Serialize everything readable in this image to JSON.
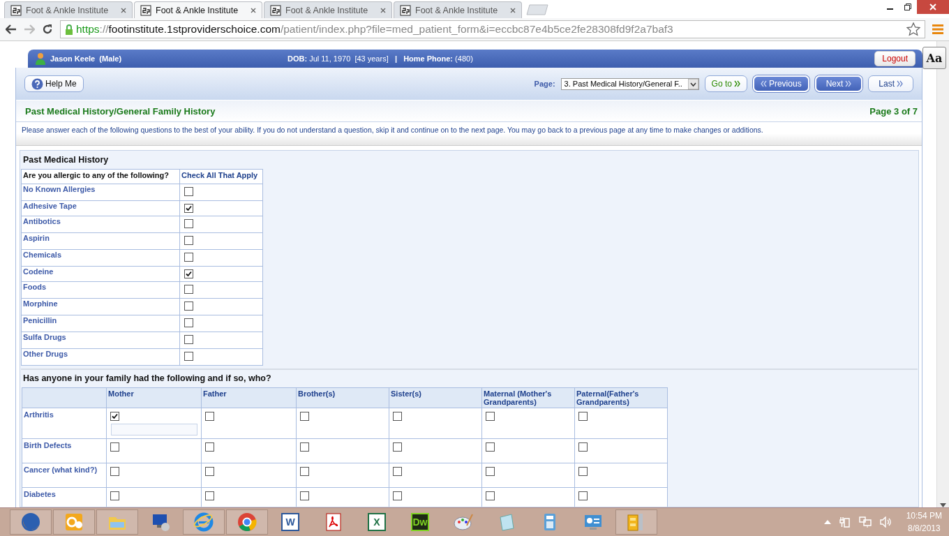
{
  "browser": {
    "tabs": [
      {
        "title": "Foot & Ankle Institute",
        "selected": false
      },
      {
        "title": "Foot & Ankle Institute",
        "selected": true
      },
      {
        "title": "Foot & Ankle Institute",
        "selected": false
      },
      {
        "title": "Foot & Ankle Institute",
        "selected": false
      }
    ],
    "url": {
      "scheme": "https",
      "separator": "://",
      "host": "footinstitute.1stproviderschoice.com",
      "path": "/patient/index.php?file=med_patient_form&i=eccbc87e4b5ce2fe28308fd9f2a7baf3"
    }
  },
  "patient": {
    "name": "Jason Keele  (Male)",
    "dob_label": "DOB:",
    "dob": "Jul 11, 1970  [43 years]",
    "separator": "|",
    "phone_label": "Home Phone:",
    "phone": "(480)"
  },
  "logout": "Logout",
  "text_size_button": "Aa",
  "help": "Help Me",
  "page_select": {
    "label": "Page:",
    "value": "3. Past Medical History/General F.."
  },
  "nav_buttons": [
    {
      "label": "Go to",
      "kind": "goto"
    },
    {
      "label": "Previous",
      "kind": "prev"
    },
    {
      "label": "Next",
      "kind": "next"
    },
    {
      "label": "Last",
      "kind": "last"
    }
  ],
  "section_title": "Past Medical History/General Family History",
  "page_count": "Page 3 of 7",
  "instructions": "Please answer each of the following questions to the best of your ability. If you do not understand a question, skip it and continue on to the next page. You may go back to a previous page at any time to make changes or additions.",
  "allergies": {
    "heading": "Past Medical History",
    "columns": [
      "Are you allergic to any of the following?",
      "Check All That Apply"
    ],
    "rows": [
      {
        "label": "No Known Allergies",
        "checked": false
      },
      {
        "label": "Adhesive Tape",
        "checked": true
      },
      {
        "label": "Antibotics",
        "checked": false
      },
      {
        "label": "Aspirin",
        "checked": false
      },
      {
        "label": "Chemicals",
        "checked": false
      },
      {
        "label": "Codeine",
        "checked": true
      },
      {
        "label": "Foods",
        "checked": false
      },
      {
        "label": "Morphine",
        "checked": false
      },
      {
        "label": "Penicillin",
        "checked": false
      },
      {
        "label": "Sulfa Drugs",
        "checked": false
      },
      {
        "label": "Other Drugs",
        "checked": false
      }
    ]
  },
  "family": {
    "question": "Has anyone in your family had the following and if so, who?",
    "columns": [
      "Mother",
      "Father",
      "Brother(s)",
      "Sister(s)",
      "Maternal (Mother's Grandparents)",
      "Paternal(Father's Grandparents)"
    ],
    "rows": [
      {
        "label": "Arthritis",
        "checks": [
          true,
          false,
          false,
          false,
          false,
          false
        ]
      },
      {
        "label": "Birth Defects",
        "checks": [
          false,
          false,
          false,
          false,
          false,
          false
        ]
      },
      {
        "label": "Cancer (what kind?)",
        "checks": [
          false,
          false,
          false,
          false,
          false,
          false
        ]
      },
      {
        "label": "Diabetes",
        "checks": [
          false,
          false,
          false,
          false,
          false,
          false
        ]
      }
    ]
  },
  "taskbar": {
    "apps": [
      {
        "kind": "firefox",
        "running": true
      },
      {
        "kind": "outlook",
        "running": true
      },
      {
        "kind": "folder",
        "running": true
      },
      {
        "kind": "remote",
        "running": false
      },
      {
        "kind": "ie",
        "running": true
      },
      {
        "kind": "chrome",
        "running": true
      },
      {
        "kind": "word",
        "running": false,
        "glyph": "W"
      },
      {
        "kind": "acrobat",
        "running": false
      },
      {
        "kind": "excel",
        "running": false,
        "glyph": "X"
      },
      {
        "kind": "dreamweaver",
        "running": false,
        "glyph": "Dw"
      },
      {
        "kind": "paint",
        "running": false
      },
      {
        "kind": "notepad",
        "running": false
      },
      {
        "kind": "calculator",
        "running": false
      },
      {
        "kind": "panel",
        "running": false
      },
      {
        "kind": "archive",
        "running": true
      }
    ],
    "clock": {
      "time": "10:54 PM",
      "date": "8/8/2013"
    }
  }
}
